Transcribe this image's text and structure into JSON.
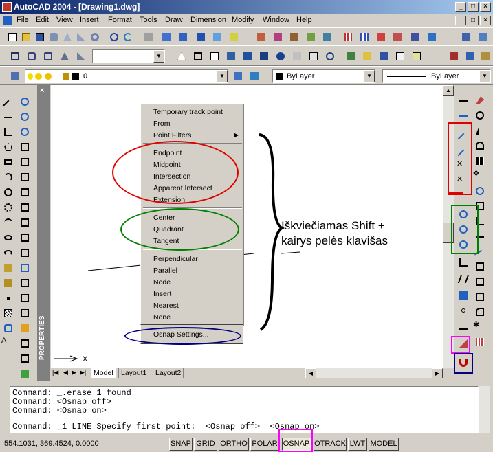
{
  "window": {
    "title": "AutoCAD 2004 - [Drawing1.dwg]",
    "min": "_",
    "max": "□",
    "close": "×"
  },
  "menu": [
    "File",
    "Edit",
    "View",
    "Insert",
    "Format",
    "Tools",
    "Draw",
    "Dimension",
    "Modify",
    "Window",
    "Help"
  ],
  "layers": {
    "layer_value": "0",
    "color_value": "ByLayer",
    "linetype_value": "ByLayer"
  },
  "context_menu": {
    "group1": [
      "Temporary track point",
      "From",
      "Point Filters"
    ],
    "group2": [
      "Endpoint",
      "Midpoint",
      "Intersection",
      "Apparent Intersect",
      "Extension"
    ],
    "group3": [
      "Center",
      "Quadrant",
      "Tangent"
    ],
    "group4": [
      "Perpendicular",
      "Parallel",
      "Node",
      "Insert",
      "Nearest",
      "None"
    ],
    "group5": [
      "Osnap Settings..."
    ]
  },
  "annotation": {
    "line1": "Iškviečiamas Shift +",
    "line2": "kairys pelės klavišas"
  },
  "tabs": [
    "Model",
    "Layout1",
    "Layout2"
  ],
  "properties_label": "PROPERTIES",
  "command_lines": [
    "Command: _.erase 1 found",
    "Command: <Osnap off>",
    "Command: <Osnap on>",
    "Command: _1 LINE Specify first point:  <Osnap off>  <Osnap on>"
  ],
  "status": {
    "coords": "554.1031, 369.4524, 0.0000",
    "buttons": [
      "SNAP",
      "GRID",
      "ORTHO",
      "POLAR",
      "OSNAP",
      "OTRACK",
      "LWT",
      "MODEL"
    ]
  },
  "colors": {
    "red": "#e00000",
    "green": "#008000",
    "navy": "#000080",
    "magenta": "#ff00ff"
  }
}
